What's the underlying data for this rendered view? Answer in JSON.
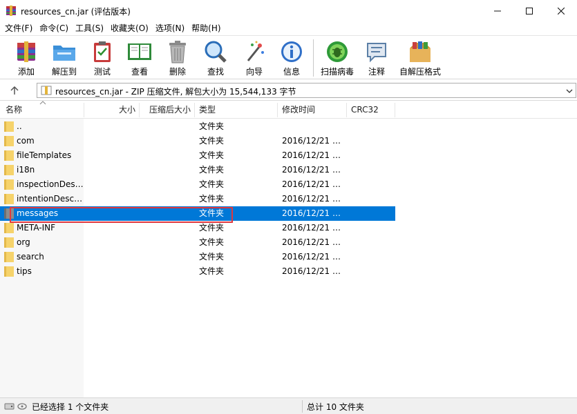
{
  "window": {
    "title": "resources_cn.jar (评估版本)"
  },
  "menu": [
    "文件(F)",
    "命令(C)",
    "工具(S)",
    "收藏夹(O)",
    "选项(N)",
    "帮助(H)"
  ],
  "toolbar": [
    {
      "label": "添加",
      "icon": "add-archive-icon"
    },
    {
      "label": "解压到",
      "icon": "extract-folder-icon"
    },
    {
      "label": "测试",
      "icon": "test-clipboard-icon"
    },
    {
      "label": "查看",
      "icon": "view-book-icon"
    },
    {
      "label": "删除",
      "icon": "trash-icon"
    },
    {
      "label": "查找",
      "icon": "magnifier-icon"
    },
    {
      "label": "向导",
      "icon": "wizard-wand-icon"
    },
    {
      "label": "信息",
      "icon": "info-icon"
    },
    {
      "label": "扫描病毒",
      "icon": "virus-scan-icon"
    },
    {
      "label": "注释",
      "icon": "comment-icon"
    },
    {
      "label": "自解压格式",
      "icon": "sfx-box-icon"
    }
  ],
  "address": {
    "text": "resources_cn.jar - ZIP 压缩文件, 解包大小为 15,544,133 字节"
  },
  "columns": {
    "name": "名称",
    "size": "大小",
    "packed": "压缩后大小",
    "type": "类型",
    "modified": "修改时间",
    "crc": "CRC32"
  },
  "rows": [
    {
      "name": "..",
      "type": "文件夹",
      "modified": ""
    },
    {
      "name": "com",
      "type": "文件夹",
      "modified": "2016/12/21 1..."
    },
    {
      "name": "fileTemplates",
      "type": "文件夹",
      "modified": "2016/12/21 1..."
    },
    {
      "name": "i18n",
      "type": "文件夹",
      "modified": "2016/12/21 1..."
    },
    {
      "name": "inspectionDesc...",
      "type": "文件夹",
      "modified": "2016/12/21 1..."
    },
    {
      "name": "intentionDescri...",
      "type": "文件夹",
      "modified": "2016/12/21 1..."
    },
    {
      "name": "messages",
      "type": "文件夹",
      "modified": "2016/12/21 1...",
      "selected": true
    },
    {
      "name": "META-INF",
      "type": "文件夹",
      "modified": "2016/12/21 1..."
    },
    {
      "name": "org",
      "type": "文件夹",
      "modified": "2016/12/21 1..."
    },
    {
      "name": "search",
      "type": "文件夹",
      "modified": "2016/12/21 1..."
    },
    {
      "name": "tips",
      "type": "文件夹",
      "modified": "2016/12/21 1..."
    }
  ],
  "status": {
    "left": "已经选择 1 个文件夹",
    "right": "总计 10 文件夹"
  },
  "colors": {
    "selection": "#0078d7",
    "highlight_outline": "#e0383e",
    "folder": "#f6d36b"
  }
}
